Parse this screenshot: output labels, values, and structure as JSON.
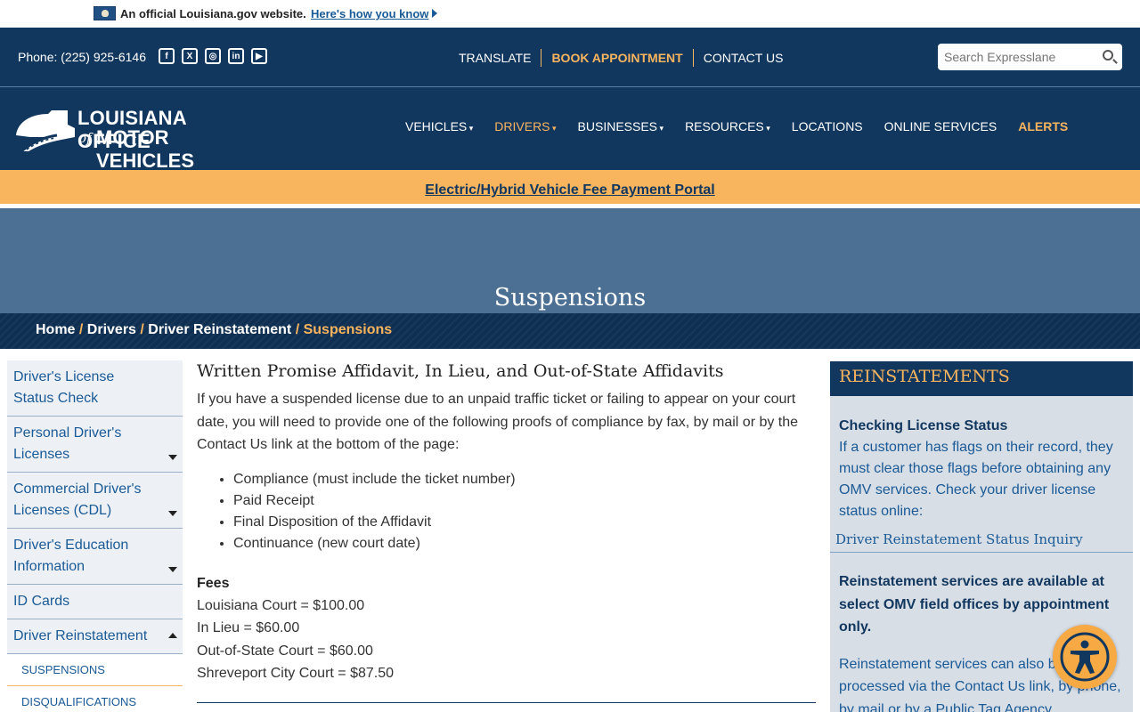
{
  "official_bar": {
    "text": "An official Louisiana.gov website.",
    "link": "Here's how you know"
  },
  "top_bar": {
    "phone": "Phone: (225) 925-6146",
    "social_icons": [
      "facebook-icon",
      "x-icon",
      "instagram-icon",
      "linkedin-icon",
      "youtube-icon"
    ],
    "links": [
      "TRANSLATE",
      "BOOK APPOINTMENT",
      "CONTACT US"
    ],
    "search_placeholder": "Search Expresslane"
  },
  "header": {
    "logo_line1": "LOUISIANA OFFICE",
    "logo_of": "of",
    "logo_line2": "MOTOR VEHICLES",
    "nav": [
      "VEHICLES",
      "DRIVERS",
      "BUSINESSES",
      "RESOURCES",
      "LOCATIONS",
      "ONLINE SERVICES",
      "ALERTS"
    ]
  },
  "alert_banner": "Electric/Hybrid Vehicle Fee Payment Portal",
  "hero": {
    "title": "Suspensions"
  },
  "breadcrumb": [
    "Home",
    "Drivers",
    "Driver Reinstatement",
    "Suspensions"
  ],
  "sidebar": {
    "items": [
      "Driver's License Status Check",
      "Personal Driver's Licenses",
      "Commercial Driver's Licenses (CDL)",
      "Driver's Education Information",
      "ID Cards",
      "Driver Reinstatement"
    ],
    "sub_items": [
      "SUSPENSIONS",
      "DISQUALIFICATIONS"
    ]
  },
  "content": {
    "heading": "Written Promise Affidavit, In Lieu, and Out-of-State Affidavits",
    "intro": "If you have a suspended license due to an unpaid traffic ticket or failing to appear on your court date, you will need to provide one of the following proofs of compliance by fax, by mail or by the Contact Us link at the bottom of the page:",
    "bullets": [
      "Compliance (must include the ticket number)",
      "Paid Receipt",
      "Final Disposition of the Affidavit",
      "Continuance (new court date)"
    ],
    "fees_heading": "Fees",
    "fees": [
      "Louisiana Court = $100.00",
      "In Lieu = $60.00",
      "Out-of-State Court = $60.00",
      "Shreveport City Court = $87.50"
    ]
  },
  "right_panel": {
    "heading": "REINSTATEMENTS",
    "status_title": "Checking License Status",
    "status_text": "If a customer has flags on their record, they must clear those flags before obtaining any OMV services. Check your driver license status online:",
    "status_link": "Driver Reinstatement Status Inquiry",
    "bold_text": "Reinstatement services are available at select OMV field offices by appointment only.",
    "more_text": "Reinstatement services can also be processed via the Contact Us link, by phone, by mail or by a Public Tag Agency"
  },
  "colors": {
    "navy": "#12375e",
    "orange": "#f9b45e",
    "link_blue": "#1a5a96",
    "hero_blue": "#4c6f94"
  }
}
